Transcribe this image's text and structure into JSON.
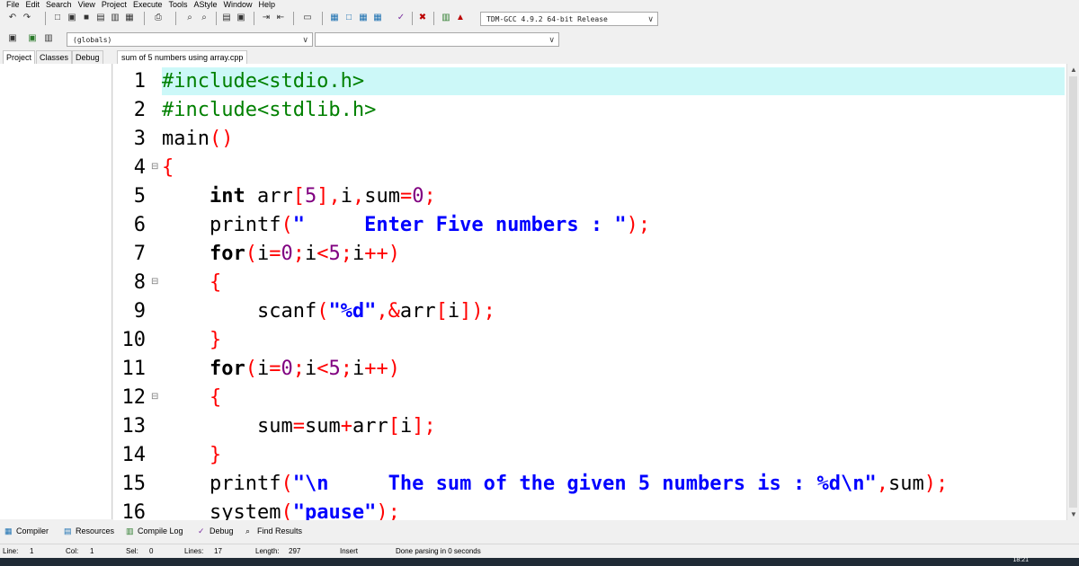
{
  "menu": [
    "File",
    "Edit",
    "Search",
    "View",
    "Project",
    "Execute",
    "Tools",
    "AStyle",
    "Window",
    "Help"
  ],
  "toolbar": {
    "compiler_select": "TDM-GCC 4.9.2 64-bit Release",
    "scope_select": "(globals)",
    "symbol_select": ""
  },
  "left_tabs": [
    "Project",
    "Classes",
    "Debug"
  ],
  "file_tab": "sum of 5 numbers using array.cpp",
  "code": {
    "lines": [
      {
        "n": "1",
        "fold": "",
        "tokens": [
          {
            "t": "#include<stdio.h>",
            "c": "pp"
          }
        ]
      },
      {
        "n": "2",
        "fold": "",
        "tokens": [
          {
            "t": "#include<stdlib.h>",
            "c": "pp"
          }
        ]
      },
      {
        "n": "3",
        "fold": "",
        "tokens": [
          {
            "t": "main",
            "c": "id"
          },
          {
            "t": "()",
            "c": "sym"
          }
        ]
      },
      {
        "n": "4",
        "fold": "⊟",
        "tokens": [
          {
            "t": "{",
            "c": "sym"
          }
        ]
      },
      {
        "n": "5",
        "fold": "",
        "tokens": [
          {
            "t": "    ",
            "c": "id"
          },
          {
            "t": "int",
            "c": "kw"
          },
          {
            "t": " arr",
            "c": "id"
          },
          {
            "t": "[",
            "c": "sym"
          },
          {
            "t": "5",
            "c": "num"
          },
          {
            "t": "],",
            "c": "sym"
          },
          {
            "t": "i",
            "c": "id"
          },
          {
            "t": ",",
            "c": "sym"
          },
          {
            "t": "sum",
            "c": "id"
          },
          {
            "t": "=",
            "c": "sym"
          },
          {
            "t": "0",
            "c": "num"
          },
          {
            "t": ";",
            "c": "sym"
          }
        ]
      },
      {
        "n": "6",
        "fold": "",
        "tokens": [
          {
            "t": "    printf",
            "c": "id"
          },
          {
            "t": "(",
            "c": "sym"
          },
          {
            "t": "\"     Enter Five numbers : \"",
            "c": "str"
          },
          {
            "t": ");",
            "c": "sym"
          }
        ]
      },
      {
        "n": "7",
        "fold": "",
        "tokens": [
          {
            "t": "    ",
            "c": "id"
          },
          {
            "t": "for",
            "c": "kw"
          },
          {
            "t": "(",
            "c": "sym"
          },
          {
            "t": "i",
            "c": "id"
          },
          {
            "t": "=",
            "c": "sym"
          },
          {
            "t": "0",
            "c": "num"
          },
          {
            "t": ";",
            "c": "sym"
          },
          {
            "t": "i",
            "c": "id"
          },
          {
            "t": "<",
            "c": "sym"
          },
          {
            "t": "5",
            "c": "num"
          },
          {
            "t": ";",
            "c": "sym"
          },
          {
            "t": "i",
            "c": "id"
          },
          {
            "t": "++)",
            "c": "sym"
          }
        ]
      },
      {
        "n": "8",
        "fold": "⊟",
        "tokens": [
          {
            "t": "    ",
            "c": "id"
          },
          {
            "t": "{",
            "c": "sym"
          }
        ]
      },
      {
        "n": "9",
        "fold": "",
        "tokens": [
          {
            "t": "        scanf",
            "c": "id"
          },
          {
            "t": "(",
            "c": "sym"
          },
          {
            "t": "\"%d\"",
            "c": "str"
          },
          {
            "t": ",&",
            "c": "sym"
          },
          {
            "t": "arr",
            "c": "id"
          },
          {
            "t": "[",
            "c": "sym"
          },
          {
            "t": "i",
            "c": "id"
          },
          {
            "t": "]);",
            "c": "sym"
          }
        ]
      },
      {
        "n": "10",
        "fold": "",
        "tokens": [
          {
            "t": "    ",
            "c": "id"
          },
          {
            "t": "}",
            "c": "sym"
          }
        ]
      },
      {
        "n": "11",
        "fold": "",
        "tokens": [
          {
            "t": "    ",
            "c": "id"
          },
          {
            "t": "for",
            "c": "kw"
          },
          {
            "t": "(",
            "c": "sym"
          },
          {
            "t": "i",
            "c": "id"
          },
          {
            "t": "=",
            "c": "sym"
          },
          {
            "t": "0",
            "c": "num"
          },
          {
            "t": ";",
            "c": "sym"
          },
          {
            "t": "i",
            "c": "id"
          },
          {
            "t": "<",
            "c": "sym"
          },
          {
            "t": "5",
            "c": "num"
          },
          {
            "t": ";",
            "c": "sym"
          },
          {
            "t": "i",
            "c": "id"
          },
          {
            "t": "++)",
            "c": "sym"
          }
        ]
      },
      {
        "n": "12",
        "fold": "⊟",
        "tokens": [
          {
            "t": "    ",
            "c": "id"
          },
          {
            "t": "{",
            "c": "sym"
          }
        ]
      },
      {
        "n": "13",
        "fold": "",
        "tokens": [
          {
            "t": "        sum",
            "c": "id"
          },
          {
            "t": "=",
            "c": "sym"
          },
          {
            "t": "sum",
            "c": "id"
          },
          {
            "t": "+",
            "c": "sym"
          },
          {
            "t": "arr",
            "c": "id"
          },
          {
            "t": "[",
            "c": "sym"
          },
          {
            "t": "i",
            "c": "id"
          },
          {
            "t": "];",
            "c": "sym"
          }
        ]
      },
      {
        "n": "14",
        "fold": "",
        "tokens": [
          {
            "t": "    ",
            "c": "id"
          },
          {
            "t": "}",
            "c": "sym"
          }
        ]
      },
      {
        "n": "15",
        "fold": "",
        "tokens": [
          {
            "t": "    printf",
            "c": "id"
          },
          {
            "t": "(",
            "c": "sym"
          },
          {
            "t": "\"\\n     The sum of the given 5 numbers is : %d\\n\"",
            "c": "str"
          },
          {
            "t": ",",
            "c": "sym"
          },
          {
            "t": "sum",
            "c": "id"
          },
          {
            "t": ");",
            "c": "sym"
          }
        ]
      },
      {
        "n": "16",
        "fold": "",
        "tokens": [
          {
            "t": "    system",
            "c": "id"
          },
          {
            "t": "(",
            "c": "sym"
          },
          {
            "t": "\"pause\"",
            "c": "str"
          },
          {
            "t": ");",
            "c": "sym"
          }
        ]
      }
    ]
  },
  "bottom_tabs": [
    {
      "label": "Compiler",
      "icon": "compiler-icon"
    },
    {
      "label": "Resources",
      "icon": "resources-icon"
    },
    {
      "label": "Compile Log",
      "icon": "compile-log-icon"
    },
    {
      "label": "Debug",
      "icon": "debug-icon"
    },
    {
      "label": "Find Results",
      "icon": "find-results-icon"
    }
  ],
  "status": {
    "line_label": "Line:",
    "line_value": "1",
    "col_label": "Col:",
    "col_value": "1",
    "sel_label": "Sel:",
    "sel_value": "0",
    "lines_label": "Lines:",
    "lines_value": "17",
    "length_label": "Length:",
    "length_value": "297",
    "mode": "Insert",
    "message": "Done parsing in 0 seconds"
  },
  "taskbar": {
    "clock": "18:21"
  }
}
